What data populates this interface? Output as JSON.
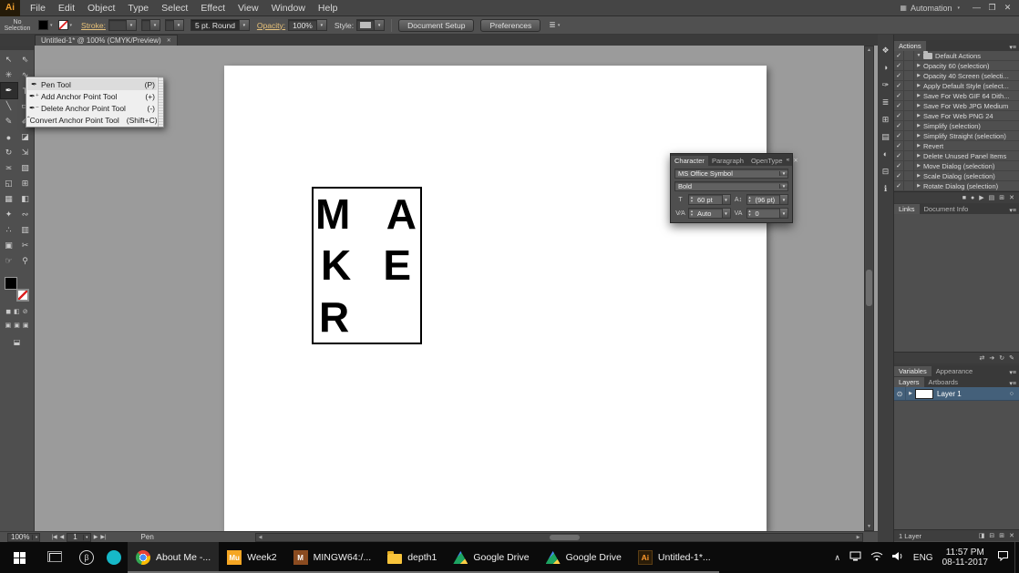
{
  "menubar": {
    "logo_text": "Ai",
    "items": [
      "File",
      "Edit",
      "Object",
      "Type",
      "Select",
      "Effect",
      "View",
      "Window",
      "Help"
    ],
    "workspace_label": "Automation"
  },
  "controlbar": {
    "selection_status": "No Selection",
    "stroke_label": "Stroke:",
    "brush_value": "5 pt. Round",
    "opacity_label": "Opacity:",
    "opacity_value": "100%",
    "style_label": "Style:",
    "document_setup_label": "Document Setup",
    "preferences_label": "Preferences"
  },
  "document_tab": {
    "title": "Untitled-1* @ 100% (CMYK/Preview)"
  },
  "toolbar": {
    "tools": [
      {
        "name": "selection-tool",
        "glyph": "↖"
      },
      {
        "name": "direct-selection-tool",
        "glyph": "⇖"
      },
      {
        "name": "magic-wand-tool",
        "glyph": "✳"
      },
      {
        "name": "lasso-tool",
        "glyph": "∿"
      },
      {
        "name": "pen-tool",
        "glyph": "✒"
      },
      {
        "name": "type-tool",
        "glyph": "T"
      },
      {
        "name": "line-segment-tool",
        "glyph": "╲"
      },
      {
        "name": "rectangle-tool",
        "glyph": "▭"
      },
      {
        "name": "paintbrush-tool",
        "glyph": "✎"
      },
      {
        "name": "pencil-tool",
        "glyph": "✐"
      },
      {
        "name": "blob-brush-tool",
        "glyph": "●"
      },
      {
        "name": "eraser-tool",
        "glyph": "◪"
      },
      {
        "name": "rotate-tool",
        "glyph": "↻"
      },
      {
        "name": "scale-tool",
        "glyph": "⇲"
      },
      {
        "name": "width-tool",
        "glyph": "≍"
      },
      {
        "name": "free-transform-tool",
        "glyph": "▧"
      },
      {
        "name": "shape-builder-tool",
        "glyph": "◱"
      },
      {
        "name": "perspective-grid-tool",
        "glyph": "⊞"
      },
      {
        "name": "mesh-tool",
        "glyph": "▦"
      },
      {
        "name": "gradient-tool",
        "glyph": "◧"
      },
      {
        "name": "eyedropper-tool",
        "glyph": "✦"
      },
      {
        "name": "blend-tool",
        "glyph": "∾"
      },
      {
        "name": "symbol-sprayer-tool",
        "glyph": "∴"
      },
      {
        "name": "column-graph-tool",
        "glyph": "▥"
      },
      {
        "name": "artboard-tool",
        "glyph": "▣"
      },
      {
        "name": "slice-tool",
        "glyph": "✂"
      },
      {
        "name": "hand-tool",
        "glyph": "☞"
      },
      {
        "name": "zoom-tool",
        "glyph": "⚲"
      }
    ]
  },
  "pen_flyout": {
    "items": [
      {
        "icon": "✒",
        "label": "Pen Tool",
        "shortcut": "(P)"
      },
      {
        "icon": "✒⁺",
        "label": "Add Anchor Point Tool",
        "shortcut": "(+)"
      },
      {
        "icon": "✒⁻",
        "label": "Delete Anchor Point Tool",
        "shortcut": "(-)"
      },
      {
        "icon": "ˆ",
        "label": "Convert Anchor Point Tool",
        "shortcut": "(Shift+C)"
      }
    ]
  },
  "artboard": {
    "letters": [
      "M",
      "A",
      "K",
      "E",
      "R"
    ]
  },
  "character_panel": {
    "tabs": [
      "Character",
      "Paragraph",
      "OpenType"
    ],
    "font_value": "MS Office Symbol",
    "style_value": "Bold",
    "size_value": "60 pt",
    "leading_value": "(96 pt)",
    "kerning_value": "Auto",
    "tracking_value": "0"
  },
  "right_strip": {
    "icons": [
      {
        "name": "symbols-panel-icon",
        "glyph": "❖"
      },
      {
        "name": "color-panel-icon",
        "glyph": "◑"
      },
      {
        "name": "brushes-panel-icon",
        "glyph": "✑"
      },
      {
        "name": "stroke-panel-icon",
        "glyph": "≣"
      },
      {
        "name": "swatches-panel-icon",
        "glyph": "⊞"
      },
      {
        "name": "graphic-styles-panel-icon",
        "glyph": "▤"
      },
      {
        "name": "color-guide-panel-icon",
        "glyph": "◐"
      },
      {
        "name": "transparency-panel-icon",
        "glyph": "⊟"
      },
      {
        "name": "info-panel-icon",
        "glyph": "ℹ"
      }
    ]
  },
  "actions_panel": {
    "title": "Actions",
    "folder_label": "Default Actions",
    "items": [
      "Opacity 60 (selection)",
      "Opacity 40 Screen (selecti...",
      "Apply Default Style (select...",
      "Save For Web GIF 64 Dith...",
      "Save For Web JPG Medium",
      "Save For Web PNG 24",
      "Simplify (selection)",
      "Simplify Straight (selection)",
      "Revert",
      "Delete Unused Panel Items",
      "Move Dialog (selection)",
      "Scale Dialog (selection)",
      "Rotate Dialog (selection)"
    ],
    "footer_icons": [
      {
        "name": "stop-icon",
        "glyph": "■"
      },
      {
        "name": "record-icon",
        "glyph": "●"
      },
      {
        "name": "play-icon",
        "glyph": "▶"
      },
      {
        "name": "new-set-icon",
        "glyph": "▤"
      },
      {
        "name": "new-action-icon",
        "glyph": "⊞"
      },
      {
        "name": "delete-action-icon",
        "glyph": "✕"
      }
    ]
  },
  "links_panel": {
    "tab_links": "Links",
    "tab_docinfo": "Document Info",
    "footer_icons": [
      {
        "name": "relink-icon",
        "glyph": "⇄"
      },
      {
        "name": "go-to-link-icon",
        "glyph": "➔"
      },
      {
        "name": "update-link-icon",
        "glyph": "↻"
      },
      {
        "name": "edit-original-icon",
        "glyph": "✎"
      }
    ]
  },
  "variables_row": {
    "tab_variables": "Variables",
    "tab_appearance": "Appearance"
  },
  "layers_panel": {
    "tab_layers": "Layers",
    "tab_artboards": "Artboards",
    "layer_name": "Layer 1",
    "footer_label": "1 Layer",
    "footer_icons": [
      {
        "name": "make-clipping-mask-icon",
        "glyph": "◨"
      },
      {
        "name": "new-sublayer-icon",
        "glyph": "⊟"
      },
      {
        "name": "new-layer-icon",
        "glyph": "⊞"
      },
      {
        "name": "delete-layer-icon",
        "glyph": "✕"
      }
    ]
  },
  "statusbar": {
    "zoom_value": "100%",
    "artboard_number": "1",
    "tool_name": "Pen"
  },
  "taskbar": {
    "apps": [
      {
        "label": "About Me -..."
      },
      {
        "label": "Week2"
      },
      {
        "label": "MINGW64:/..."
      },
      {
        "label": "depth1"
      },
      {
        "label": "Google Drive"
      },
      {
        "label": "Google Drive"
      },
      {
        "label": "Untitled-1*..."
      }
    ],
    "tray": {
      "language": "ENG",
      "time": "11:57 PM",
      "date": "08-11-2017"
    }
  }
}
